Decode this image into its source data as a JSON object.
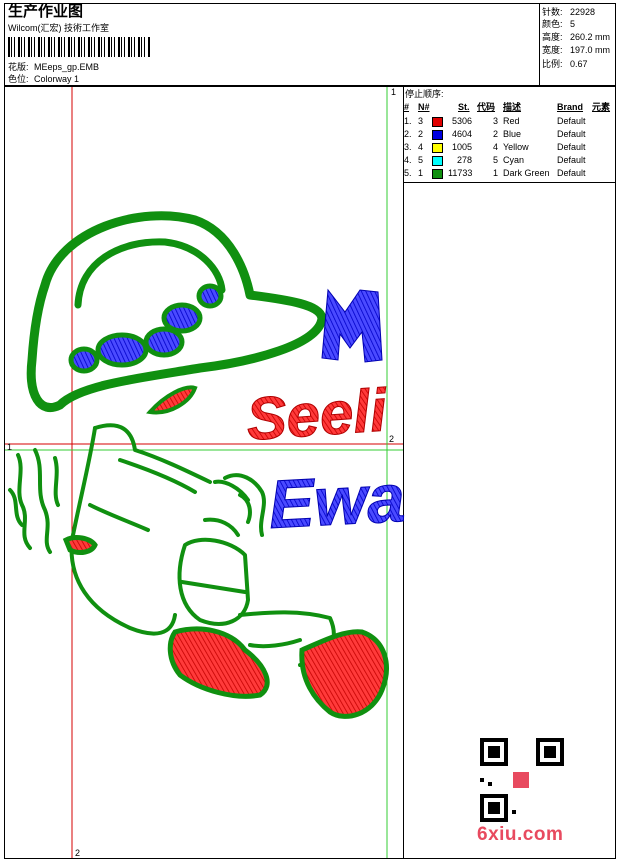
{
  "header": {
    "title": "生产作业图",
    "subtitle": "Wilcom(汇宏) 技術工作室",
    "design_label": "花版:",
    "design_value": "MEeps_gp.EMB",
    "colorway_label": "色位:",
    "colorway_value": "Colorway 1"
  },
  "stats": [
    {
      "label": "针数:",
      "value": "22928"
    },
    {
      "label": "颜色:",
      "value": "5"
    },
    {
      "label": "高度:",
      "value": "260.2 mm"
    },
    {
      "label": "宽度:",
      "value": "197.0 mm"
    },
    {
      "label": "比例:",
      "value": "0.67"
    }
  ],
  "stop_sequence": {
    "title": "停止顺序:",
    "headers": [
      "#",
      "N#",
      "St.",
      "代码",
      "描述",
      "Brand",
      "元素"
    ],
    "rows": [
      {
        "num": "1.",
        "n": "3",
        "color": "#e00000",
        "st": "5306",
        "code": "3",
        "desc": "Red",
        "brand": "Default"
      },
      {
        "num": "2.",
        "n": "2",
        "color": "#0000e0",
        "st": "4604",
        "code": "2",
        "desc": "Blue",
        "brand": "Default"
      },
      {
        "num": "3.",
        "n": "4",
        "color": "#ffff00",
        "st": "1005",
        "code": "4",
        "desc": "Yellow",
        "brand": "Default"
      },
      {
        "num": "4.",
        "n": "5",
        "color": "#00ffff",
        "st": "278",
        "code": "5",
        "desc": "Cyan",
        "brand": "Default"
      },
      {
        "num": "5.",
        "n": "1",
        "color": "#109010",
        "st": "11733",
        "code": "1",
        "desc": "Dark Green",
        "brand": "Default"
      }
    ]
  },
  "guides": {
    "marker_1": "1",
    "marker_2": "2"
  },
  "design_text": [
    "M",
    "Seeli",
    "Ewa"
  ],
  "brand": {
    "logo": "6xiu.com"
  },
  "colors": {
    "red": "#e00000",
    "blue": "#1a1ae0",
    "green": "#109010",
    "guide_red": "#d40000",
    "guide_green": "#33cc33"
  }
}
